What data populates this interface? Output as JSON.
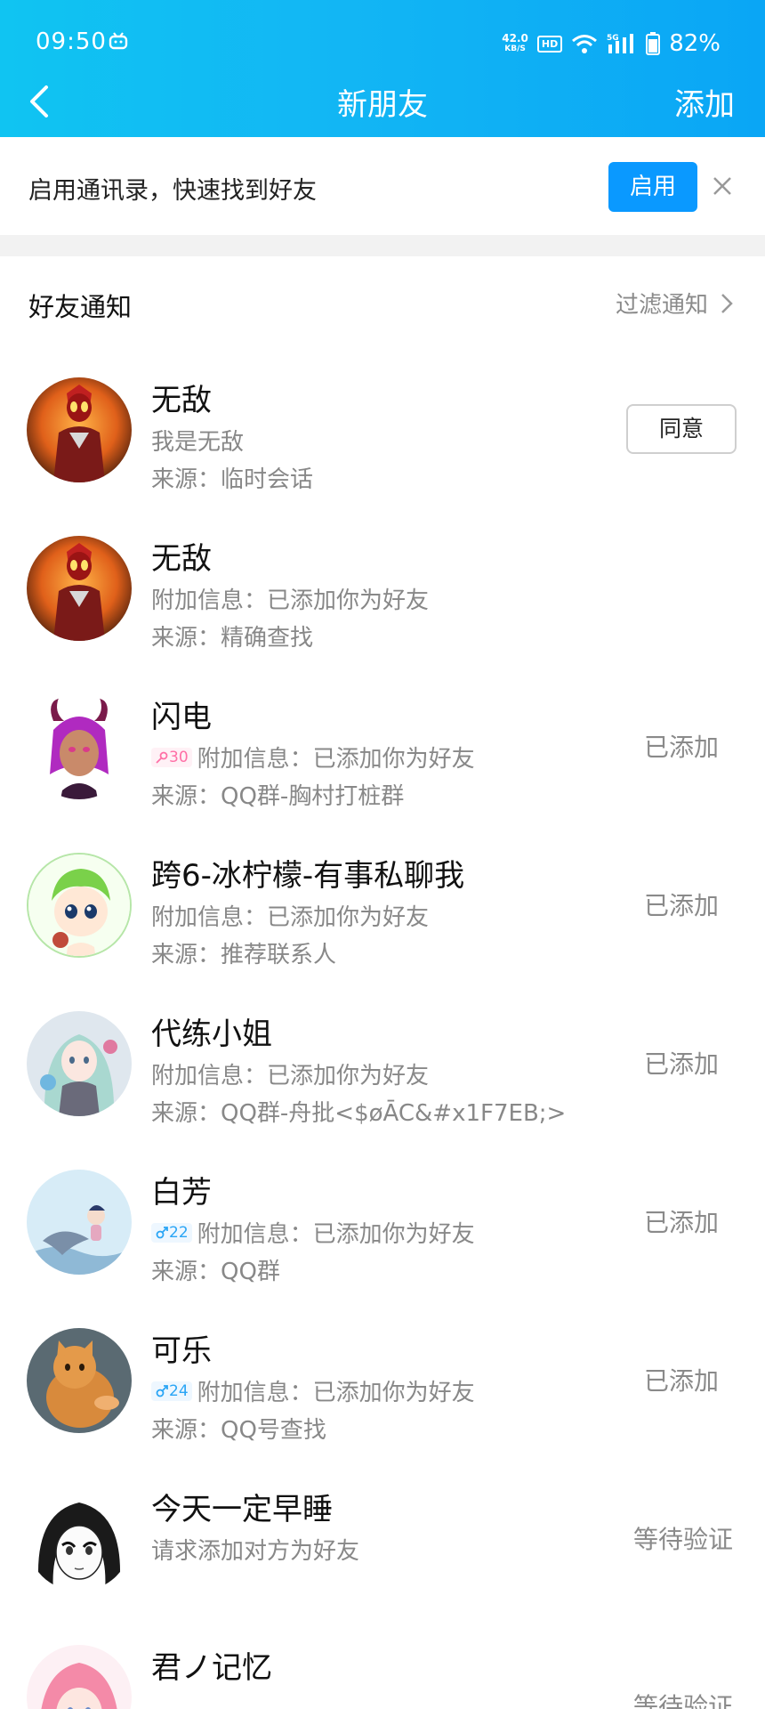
{
  "status_bar": {
    "time": "09:50",
    "net_speed_top": "42.0",
    "net_speed_unit": "KB/S",
    "hd": "HD",
    "signal": "5G",
    "battery": "82%"
  },
  "nav": {
    "title": "新朋友",
    "add_label": "添加"
  },
  "banner": {
    "text": "启用通讯录，快速找到好友",
    "enable_label": "启用"
  },
  "section": {
    "title": "好友通知",
    "filter_label": "过滤通知"
  },
  "colors": {
    "accent": "#0a99ff",
    "header_start": "#10c4f2",
    "header_end": "#0aa6f5"
  },
  "requests": [
    {
      "name": "无敌",
      "line2": "我是无敌",
      "line3": "来源：临时会话",
      "action": "同意",
      "avatar": "ultraman-avatar"
    },
    {
      "name": "无敌",
      "line2": "附加信息：已添加你为好友",
      "line3": "来源：精确查找",
      "action": "",
      "avatar": "ultraman-avatar"
    },
    {
      "name": "闪电",
      "tag": "30",
      "gender": "female",
      "line2": "附加信息：已添加你为好友",
      "line3": "来源：QQ群-胸村打桩群",
      "action": "已添加",
      "avatar": "demon-girl-avatar"
    },
    {
      "name": "跨6-冰柠檬-有事私聊我",
      "line2": "附加信息：已添加你为好友",
      "line3": "来源：推荐联系人",
      "action": "已添加",
      "avatar": "green-hair-chibi-avatar"
    },
    {
      "name": "代练小姐",
      "line2": "附加信息：已添加你为好友",
      "line3": "来源：QQ群-舟批<$øĀC&#x1F7EB;>",
      "action": "已添加",
      "avatar": "anime-girl-avatar"
    },
    {
      "name": "白芳",
      "tag": "22",
      "gender": "male",
      "line2": "附加信息：已添加你为好友",
      "line3": "来源：QQ群",
      "action": "已添加",
      "avatar": "mermaid-avatar"
    },
    {
      "name": "可乐",
      "tag": "24",
      "gender": "male",
      "line2": "附加信息：已添加你为好友",
      "line3": "来源：QQ号查找",
      "action": "已添加",
      "avatar": "orange-cat-avatar"
    },
    {
      "name": "今天一定早睡",
      "line2": "请求添加对方为好友",
      "line3": "",
      "action": "等待验证",
      "avatar": "manga-girl-avatar"
    },
    {
      "name": "君ノ记忆",
      "line2": "",
      "line3": "",
      "action": "等待验证",
      "avatar": "pink-hair-avatar"
    }
  ]
}
